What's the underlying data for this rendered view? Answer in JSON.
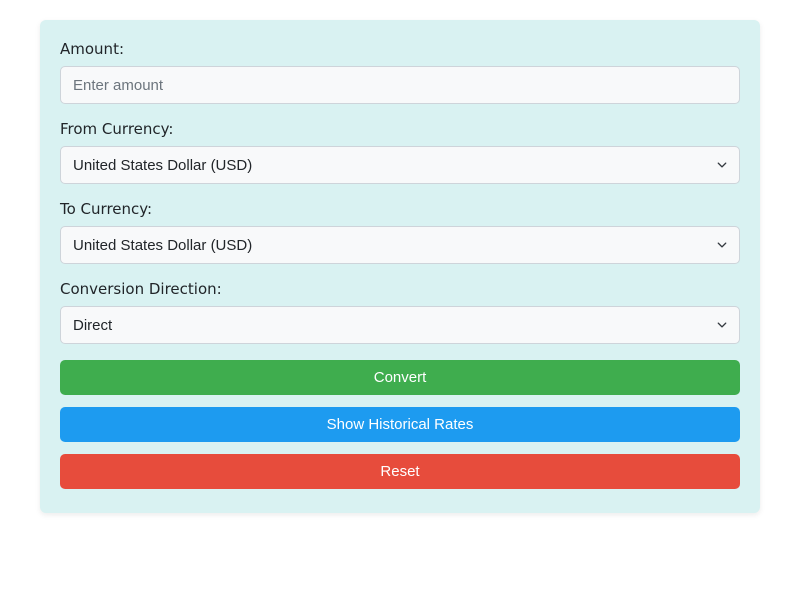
{
  "form": {
    "amount": {
      "label": "Amount:",
      "placeholder": "Enter amount",
      "value": ""
    },
    "fromCurrency": {
      "label": "From Currency:",
      "selected": "United States Dollar (USD)"
    },
    "toCurrency": {
      "label": "To Currency:",
      "selected": "United States Dollar (USD)"
    },
    "direction": {
      "label": "Conversion Direction:",
      "selected": "Direct"
    }
  },
  "buttons": {
    "convert": "Convert",
    "historical": "Show Historical Rates",
    "reset": "Reset"
  },
  "colors": {
    "cardBg": "#d9f2f2",
    "success": "#3fad4e",
    "info": "#1d9bf0",
    "danger": "#e74c3c"
  }
}
